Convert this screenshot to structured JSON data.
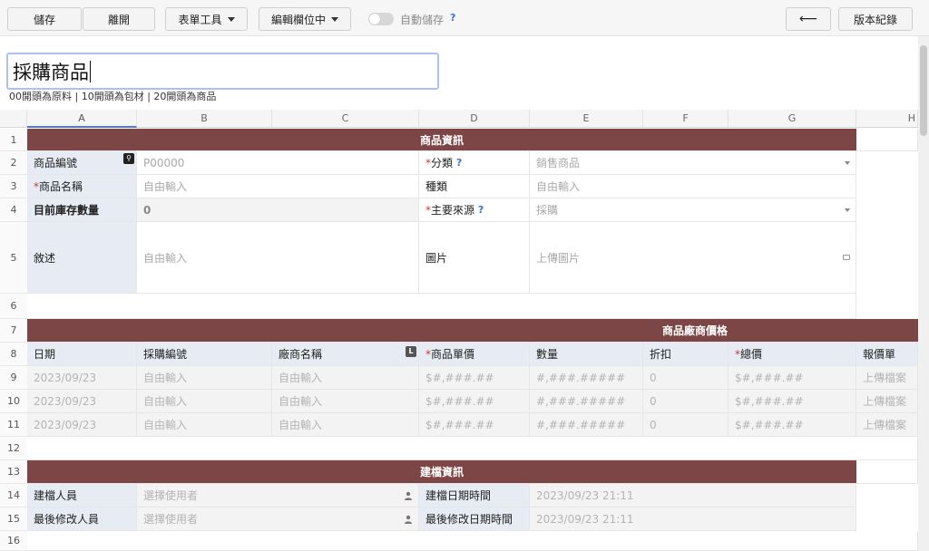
{
  "toolbar": {
    "save": "儲存",
    "leave": "離開",
    "form_tools": "表單工具",
    "edit_fields": "編輯欄位中",
    "autosave": "自動儲存",
    "help": "?",
    "back_arrow": "⟵",
    "version_history": "版本紀錄"
  },
  "form": {
    "title": "採購商品",
    "subtitle": "00開頭為原料 | 10開頭為包材 | 20開頭為商品"
  },
  "columns": [
    "A",
    "B",
    "C",
    "D",
    "E",
    "F",
    "G",
    "H"
  ],
  "rows": [
    "1",
    "2",
    "3",
    "4",
    "5",
    "6",
    "7",
    "8",
    "9",
    "10",
    "11",
    "12",
    "13",
    "14",
    "15",
    "16"
  ],
  "section1": {
    "band": "商品資訊",
    "product_code_label": "商品編號",
    "product_code_value": "P00000",
    "category_label": "分類",
    "category_value": "銷售商品",
    "product_name_label": "商品名稱",
    "product_name_ph": "自由輸入",
    "type_label": "種類",
    "type_ph": "自由輸入",
    "stock_label": "目前庫存數量",
    "stock_value": "0",
    "source_label": "主要來源",
    "source_value": "採購",
    "desc_label": "敘述",
    "desc_ph": "自由輸入",
    "image_label": "圖片",
    "image_ph": "上傳圖片",
    "required_mark": "*",
    "help": "?"
  },
  "section2": {
    "band": "商品廠商價格",
    "headers": {
      "date": "日期",
      "po_no": "採購編號",
      "vendor": "廠商名稱",
      "unit_price": "商品單價",
      "qty": "數量",
      "discount": "折扣",
      "total": "總價",
      "quote": "報價單"
    },
    "rows": [
      {
        "date": "2023/09/23",
        "po_no": "自由輸入",
        "vendor": "自由輸入",
        "unit_price": "$#,###.##",
        "qty": "#,###.#####",
        "discount": "0",
        "total": "$#,###.##",
        "quote": "上傳檔案"
      },
      {
        "date": "2023/09/23",
        "po_no": "自由輸入",
        "vendor": "自由輸入",
        "unit_price": "$#,###.##",
        "qty": "#,###.#####",
        "discount": "0",
        "total": "$#,###.##",
        "quote": "上傳檔案"
      },
      {
        "date": "2023/09/23",
        "po_no": "自由輸入",
        "vendor": "自由輸入",
        "unit_price": "$#,###.##",
        "qty": "#,###.#####",
        "discount": "0",
        "total": "$#,###.##",
        "quote": "上傳檔案"
      }
    ]
  },
  "section3": {
    "band": "建檔資訊",
    "creator_label": "建檔人員",
    "creator_ph": "選擇使用者",
    "created_label": "建檔日期時間",
    "created_value": "2023/09/23 21:11",
    "modifier_label": "最後修改人員",
    "modifier_ph": "選擇使用者",
    "modified_label": "最後修改日期時間",
    "modified_value": "2023/09/23 21:11"
  },
  "colors": {
    "band": "#7d4646",
    "label_bg": "#e7ebf3",
    "required": "#c43d3d",
    "help": "#3a74c9",
    "focus": "#a9c2ee"
  }
}
